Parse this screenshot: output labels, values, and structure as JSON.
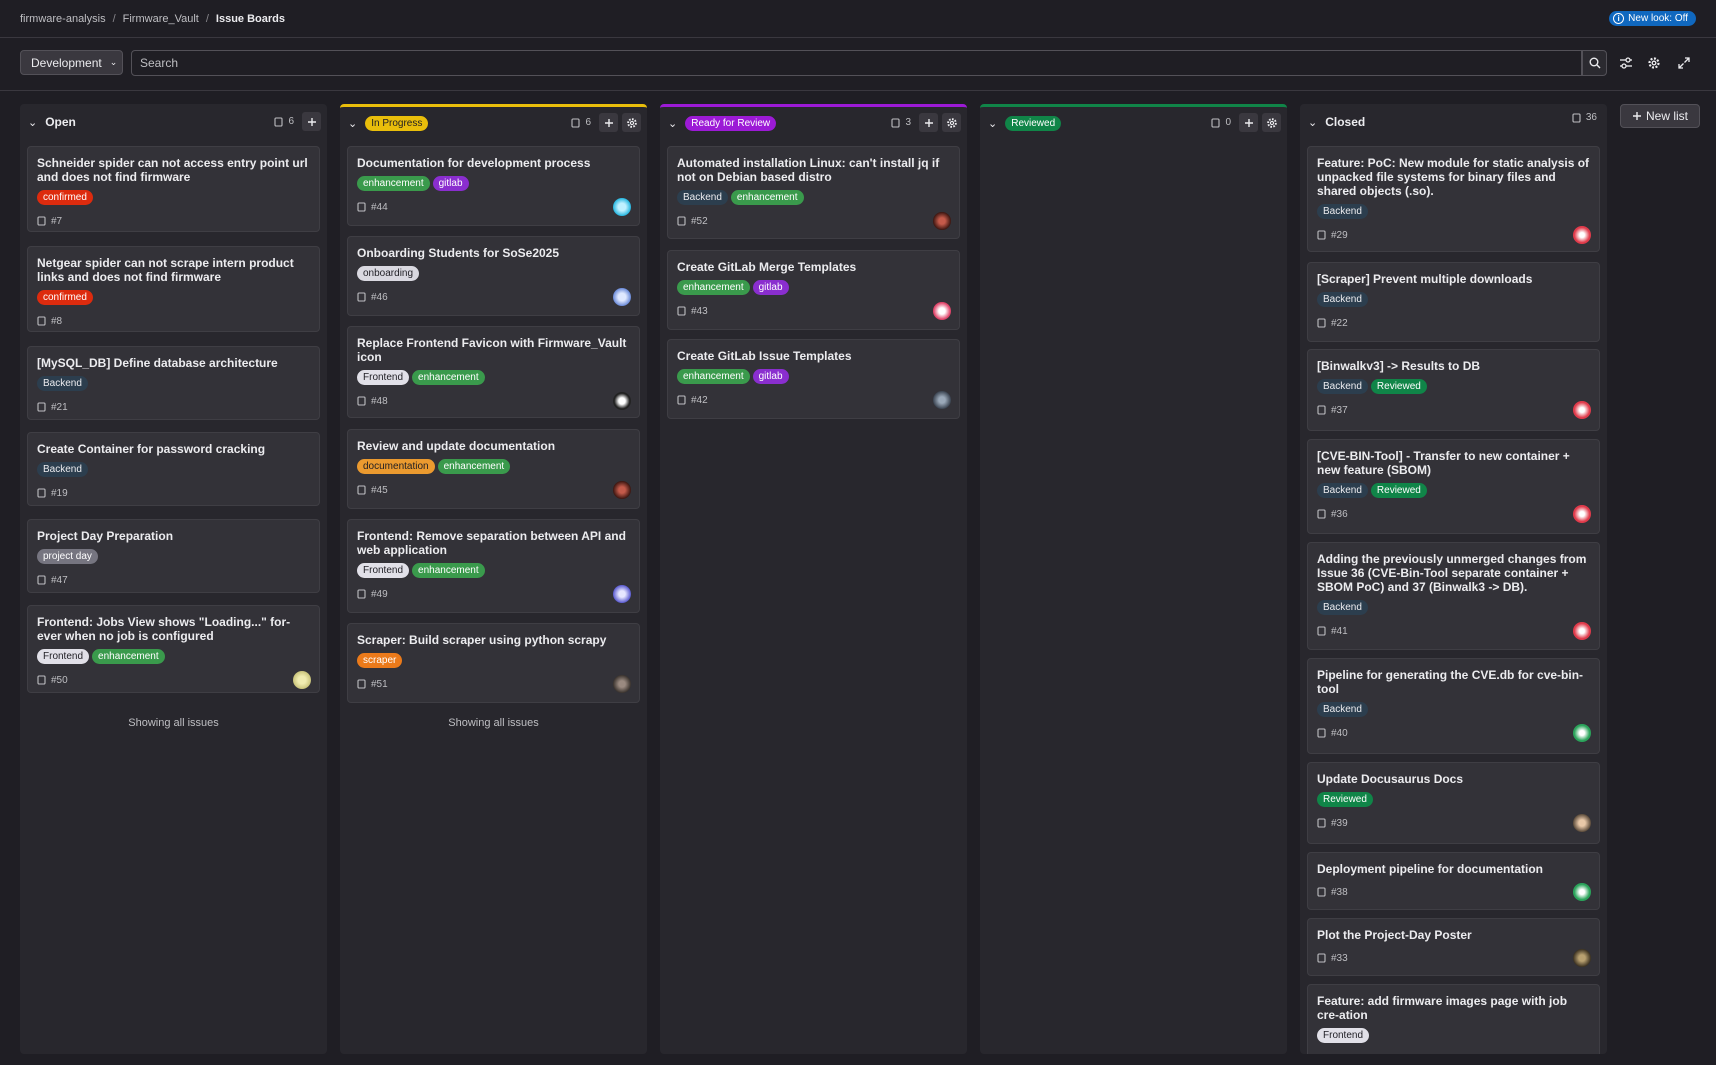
{
  "breadcrumb": [
    "firmware-analysis",
    "Firmware_Vault",
    "Issue Boards"
  ],
  "new_look": "New look: Off",
  "filter": {
    "board": "Development",
    "search_placeholder": "Search"
  },
  "new_list": "New list",
  "show_all": "Showing all issues",
  "lists": {
    "open": {
      "title": "Open",
      "count": "6",
      "cards": [
        {
          "title": "Schneider spider can not access entry point url and does not find firmware",
          "labels": [
            "confirmed"
          ],
          "id": "#7"
        },
        {
          "title": "Netgear spider can not scrape intern product links and does not find firmware",
          "labels": [
            "confirmed"
          ],
          "id": "#8"
        },
        {
          "title": "[MySQL_DB] Define database architecture",
          "labels": [
            "Backend"
          ],
          "id": "#21"
        },
        {
          "title": "Create Container for password cracking",
          "labels": [
            "Backend"
          ],
          "id": "#19"
        },
        {
          "title": "Project Day Preparation",
          "labels": [
            "project day"
          ],
          "id": "#47"
        },
        {
          "title": "Frontend: Jobs View shows \"Loading...\" for-ever when no job is configured",
          "labels": [
            "Frontend",
            "enhancement"
          ],
          "id": "#50"
        }
      ]
    },
    "inprogress": {
      "title": "In Progress",
      "count": "6",
      "cards": [
        {
          "title": "Documentation for development process",
          "labels": [
            "enhancement",
            "gitlab"
          ],
          "id": "#44"
        },
        {
          "title": "Onboarding Students for SoSe2025",
          "labels": [
            "onboarding"
          ],
          "id": "#46"
        },
        {
          "title": "Replace Frontend Favicon with Firmware_Vault icon",
          "labels": [
            "Frontend",
            "enhancement"
          ],
          "id": "#48"
        },
        {
          "title": "Review and update documentation",
          "labels": [
            "documentation",
            "enhancement"
          ],
          "id": "#45"
        },
        {
          "title": "Frontend: Remove separation between API and web application",
          "labels": [
            "Frontend",
            "enhancement"
          ],
          "id": "#49"
        },
        {
          "title": "Scraper: Build scraper using python scrapy",
          "labels": [
            "scraper"
          ],
          "id": "#51"
        }
      ]
    },
    "ready": {
      "title": "Ready for Review",
      "count": "3",
      "cards": [
        {
          "title": "Automated installation Linux: can't install jq if not on Debian based distro",
          "labels": [
            "Backend",
            "enhancement"
          ],
          "id": "#52"
        },
        {
          "title": "Create GitLab Merge Templates",
          "labels": [
            "enhancement",
            "gitlab"
          ],
          "id": "#43"
        },
        {
          "title": "Create GitLab Issue Templates",
          "labels": [
            "enhancement",
            "gitlab"
          ],
          "id": "#42"
        }
      ]
    },
    "reviewed": {
      "title": "Reviewed",
      "count": "0"
    },
    "closed": {
      "title": "Closed",
      "count": "36",
      "cards": [
        {
          "title": "Feature: PoC: New module for static analysis of unpacked file systems for binary files and shared objects (.so).",
          "labels": [
            "Backend"
          ],
          "id": "#29"
        },
        {
          "title": "[Scraper] Prevent multiple downloads",
          "labels": [
            "Backend"
          ],
          "id": "#22"
        },
        {
          "title": "[Binwalkv3] -> Results to DB",
          "labels": [
            "Backend",
            "Reviewed"
          ],
          "id": "#37"
        },
        {
          "title": "[CVE-BIN-Tool] - Transfer to new container + new feature (SBOM)",
          "labels": [
            "Backend",
            "Reviewed"
          ],
          "id": "#36"
        },
        {
          "title": "Adding the previously unmerged changes from Issue 36 (CVE-Bin-Tool separate container + SBOM PoC) and 37 (Binwalk3 -> DB).",
          "labels": [
            "Backend"
          ],
          "id": "#41"
        },
        {
          "title": "Pipeline for generating the CVE.db for cve-bin-tool",
          "labels": [
            "Backend"
          ],
          "id": "#40"
        },
        {
          "title": "Update Docusaurus Docs",
          "labels": [
            "Reviewed"
          ],
          "id": "#39"
        },
        {
          "title": "Deployment pipeline for documentation",
          "labels": [],
          "id": "#38"
        },
        {
          "title": "Plot the Project-Day Poster",
          "labels": [],
          "id": "#33"
        },
        {
          "title": "Feature: add firmware images page with job cre-ation",
          "labels": [
            "Frontend"
          ],
          "id": ""
        }
      ]
    }
  }
}
